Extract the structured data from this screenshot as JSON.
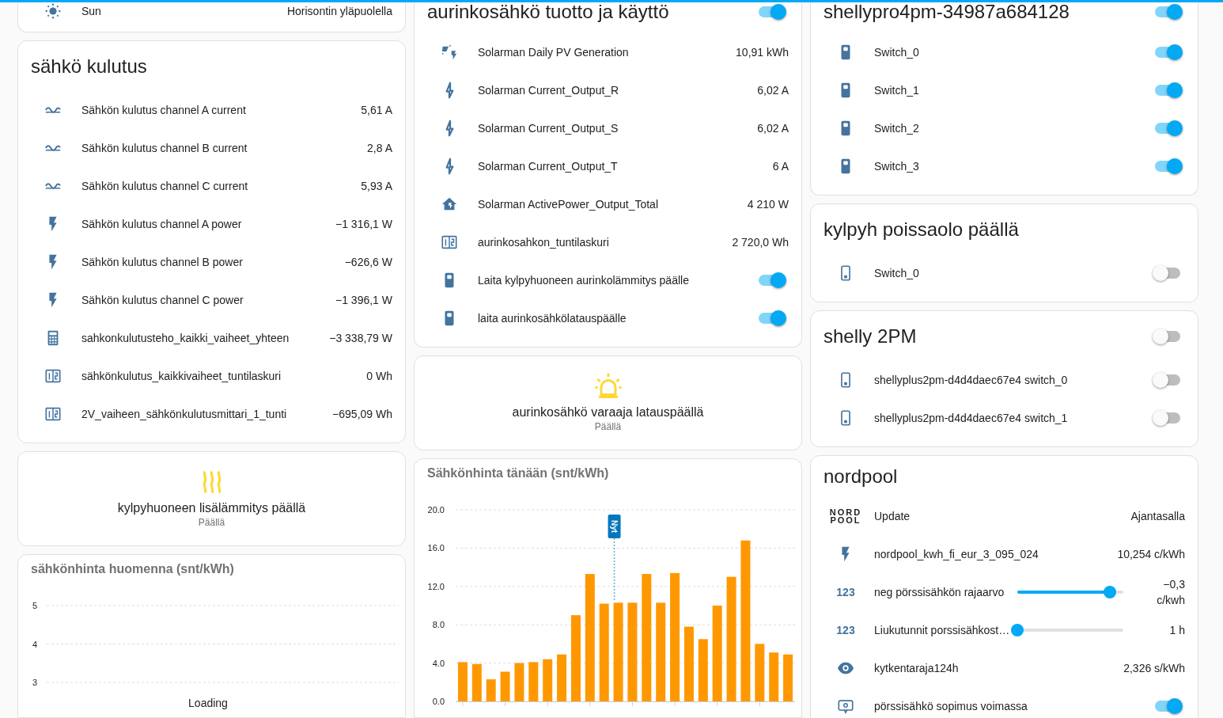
{
  "columns": [
    {
      "cards": [
        {
          "kind": "entities",
          "rows": [
            {
              "kind": "sensor",
              "name": "Sun",
              "value": "Horisontin yläpuolella"
            }
          ]
        },
        {
          "kind": "entities",
          "title": "sähkö kulutus",
          "rows": [
            {
              "kind": "sensor",
              "name": "Sähkön kulutus channel A current",
              "value": "5,61 A"
            },
            {
              "kind": "sensor",
              "name": "Sähkön kulutus channel B current",
              "value": "2,8 A"
            },
            {
              "kind": "sensor",
              "name": "Sähkön kulutus channel C current",
              "value": "5,93 A"
            },
            {
              "kind": "sensor",
              "name": "Sähkön kulutus channel A power",
              "value": "−1 316,1 W"
            },
            {
              "kind": "sensor",
              "name": "Sähkön kulutus channel B power",
              "value": "−626,6 W"
            },
            {
              "kind": "sensor",
              "name": "Sähkön kulutus channel C power",
              "value": "−1 396,1 W"
            },
            {
              "kind": "sensor",
              "name": "sahkonkulutusteho_kaikki_vaiheet_yhteen",
              "value": "−3 338,79 W"
            },
            {
              "kind": "sensor",
              "name": "sähkönkulutus_kaikkivaiheet_tuntilaskuri",
              "value": "0 Wh"
            },
            {
              "kind": "sensor",
              "name": "2V_vaiheen_sähkönkulutusmittari_1_tunti",
              "value": "−695,09 Wh"
            }
          ]
        },
        {
          "kind": "button",
          "name": "kylpyhuoneen lisälämmitys päällä",
          "state": "Päällä",
          "on": true
        },
        {
          "kind": "chart_placeholder",
          "title": "sähkönhinta huomenna (snt/kWh)",
          "axis_labels": [
            "5",
            "4",
            "3"
          ],
          "status": "Loading"
        }
      ]
    },
    {
      "cards": [
        {
          "kind": "entities",
          "title": "aurinkosähkö tuotto ja käyttö",
          "header_on": true,
          "rows": [
            {
              "kind": "sensor",
              "name": "Solarman Daily PV Generation",
              "value": "10,91 kWh"
            },
            {
              "kind": "sensor",
              "name": "Solarman Current_Output_R",
              "value": "6,02 A"
            },
            {
              "kind": "sensor",
              "name": "Solarman Current_Output_S",
              "value": "6,02 A"
            },
            {
              "kind": "sensor",
              "name": "Solarman Current_Output_T",
              "value": "6 A"
            },
            {
              "kind": "sensor",
              "name": "Solarman ActivePower_Output_Total",
              "value": "4 210 W"
            },
            {
              "kind": "sensor",
              "name": "aurinkosahkon_tuntilaskuri",
              "value": "2 720,0 Wh"
            },
            {
              "kind": "toggle",
              "name": "Laita kylpyhuoneen aurinkolämmitys päälle",
              "on": true
            },
            {
              "kind": "toggle",
              "name": "laita aurinkosähkölatauspäälle",
              "on": true
            }
          ]
        },
        {
          "kind": "button",
          "name": "aurinkosähkö varaaja latauspäällä",
          "state": "Päällä",
          "on": true
        },
        {
          "kind": "chart",
          "chart_data": {
            "type": "bar",
            "title": "Sähkönhinta tänään (snt/kWh)",
            "grid": true,
            "categories": [
              null,
              null,
              null,
              null,
              null,
              null,
              null,
              null,
              null,
              null,
              null,
              null,
              null,
              null,
              null,
              null,
              null,
              null,
              null,
              null,
              null,
              null,
              null,
              null
            ],
            "ylim": [
              0,
              20
            ],
            "yticks": [
              {
                "value": 0,
                "label": "0.0"
              },
              {
                "value": 4,
                "label": "4.0"
              },
              {
                "value": 8,
                "label": "8.0"
              },
              {
                "value": 12,
                "label": "12.0"
              },
              {
                "value": 16,
                "label": "16.0"
              },
              {
                "value": 20,
                "label": "20.0"
              }
            ],
            "values": [
              4.1,
              3.9,
              2.3,
              3.1,
              4.0,
              4.1,
              4.4,
              4.9,
              9.0,
              13.3,
              10.2,
              10.3,
              10.3,
              13.3,
              10.3,
              13.4,
              7.8,
              6.5,
              10.0,
              13.0,
              16.8,
              6.0,
              5.1,
              4.9
            ],
            "annotations": [
              "Nyt"
            ]
          }
        }
      ]
    },
    {
      "cards": [
        {
          "kind": "entities",
          "title": "shellypro4pm-34987a684128",
          "header_on": true,
          "rows": [
            {
              "kind": "toggle",
              "name": "Switch_0",
              "on": true
            },
            {
              "kind": "toggle",
              "name": "Switch_1",
              "on": true
            },
            {
              "kind": "toggle",
              "name": "Switch_2",
              "on": true
            },
            {
              "kind": "toggle",
              "name": "Switch_3",
              "on": true
            }
          ]
        },
        {
          "kind": "entities",
          "title": "kylpyh poissaolo päällä",
          "rows": [
            {
              "kind": "toggle",
              "name": "Switch_0",
              "on": false
            }
          ]
        },
        {
          "kind": "entities",
          "title": "shelly 2PM",
          "header_on": false,
          "rows": [
            {
              "kind": "toggle",
              "name": "shellyplus2pm-d4d4daec67e4 switch_0",
              "on": false
            },
            {
              "kind": "toggle",
              "name": "shellyplus2pm-d4d4daec67e4 switch_1",
              "on": false
            }
          ]
        },
        {
          "kind": "entities",
          "title": "nordpool",
          "rows": [
            {
              "kind": "sensor",
              "icon_text": [
                "NORD",
                "POOL"
              ],
              "name": "Update",
              "value": "Ajantasalla"
            },
            {
              "kind": "sensor",
              "name": "nordpool_kwh_fi_eur_3_095_024",
              "value": "10,254 c/kWh"
            },
            {
              "kind": "slider",
              "icon_text": [
                "123"
              ],
              "name": "neg pörssisähkön rajaarvo",
              "level": 0.87,
              "value": "−0,3 c/kwh"
            },
            {
              "kind": "slider",
              "icon_text": [
                "123"
              ],
              "name": "Liukutunnit porssisähkost…",
              "level": 0,
              "value": "1 h"
            },
            {
              "kind": "sensor",
              "name": "kytkentaraja124h",
              "value": "2,326 s/kWh"
            },
            {
              "kind": "toggle",
              "name": "pörssisähkö sopimus voimassa",
              "on": true
            }
          ]
        }
      ]
    }
  ]
}
